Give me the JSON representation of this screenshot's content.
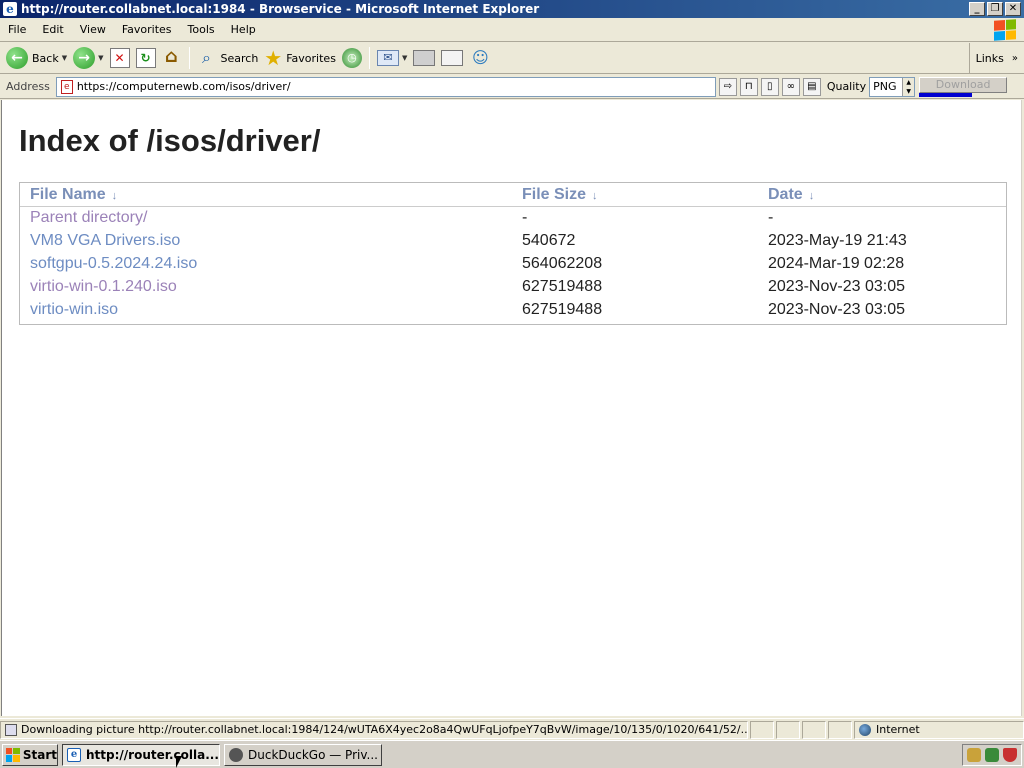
{
  "window": {
    "title": "http://router.collabnet.local:1984 - Browservice - Microsoft Internet Explorer",
    "controls": {
      "minimize": "_",
      "maximize": "❐",
      "close": "✕"
    }
  },
  "menu": [
    "File",
    "Edit",
    "View",
    "Favorites",
    "Tools",
    "Help"
  ],
  "toolbar": {
    "back_label": "Back",
    "search_label": "Search",
    "favorites_label": "Favorites",
    "links_label": "Links",
    "links_chevron": "»"
  },
  "address": {
    "label": "Address",
    "url": "https://computernewb.com/isos/driver/",
    "quality_label": "Quality",
    "quality_value": "PNG",
    "download_label": "Download",
    "download_progress": 0.6
  },
  "page": {
    "title": "Index of /isos/driver/",
    "columns": [
      {
        "label": "File Name",
        "arrow": "↓"
      },
      {
        "label": "File Size",
        "arrow": "↓"
      },
      {
        "label": "Date",
        "arrow": "↓"
      }
    ],
    "rows": [
      {
        "name": "Parent directory/",
        "size": "-",
        "date": "-",
        "visited": true
      },
      {
        "name": "VM8 VGA Drivers.iso",
        "size": "540672",
        "date": "2023-May-19 21:43",
        "visited": false
      },
      {
        "name": "softgpu-0.5.2024.24.iso",
        "size": "564062208",
        "date": "2024-Mar-19 02:28",
        "visited": false
      },
      {
        "name": "virtio-win-0.1.240.iso",
        "size": "627519488",
        "date": "2023-Nov-23 03:05",
        "visited": true
      },
      {
        "name": "virtio-win.iso",
        "size": "627519488",
        "date": "2023-Nov-23 03:05",
        "visited": false
      }
    ]
  },
  "status": {
    "text": "Downloading picture http://router.collabnet.local:1984/124/wUTA6X4yec2o8a4QwUFqLjofpeY7qBvW/image/10/135/0/1020/641/52/...",
    "zone": "Internet"
  },
  "taskbar": {
    "start_label": "Start",
    "tasks": [
      {
        "label": "http://router.colla...",
        "active": true
      },
      {
        "label": "DuckDuckGo — Priv...",
        "active": false
      }
    ]
  },
  "colors": {
    "link": "#6d8cc2",
    "visited": "#9b82b8",
    "header": "#7a8fb8"
  }
}
